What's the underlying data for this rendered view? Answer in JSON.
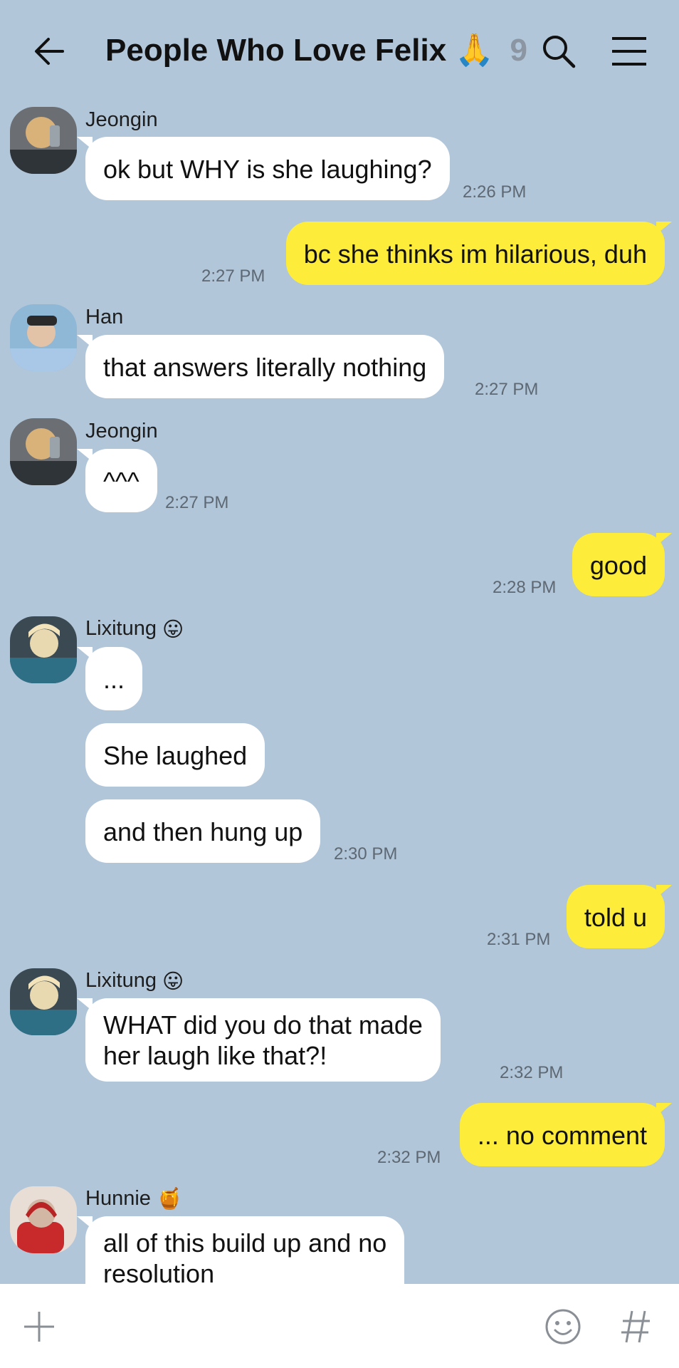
{
  "header": {
    "title": "People Who Love Felix",
    "title_emoji": "🙏",
    "member_count": "9",
    "icons": [
      "back-arrow-icon",
      "search-icon",
      "menu-icon"
    ]
  },
  "colors": {
    "background": "#b2c6da",
    "incoming_bubble": "#ffffff",
    "outgoing_bubble": "#fdec3a"
  },
  "messages": [
    {
      "sender": "Jeongin",
      "text": "ok but WHY is she laughing?",
      "time": "2:26 PM"
    },
    {
      "sender": "me",
      "text": "bc she thinks im hilarious, duh",
      "time": "2:27 PM"
    },
    {
      "sender": "Han",
      "text": "that answers literally nothing",
      "time": "2:27 PM"
    },
    {
      "sender": "Jeongin",
      "text": "^^^",
      "time": "2:27 PM"
    },
    {
      "sender": "me",
      "text": "good",
      "time": "2:28 PM"
    },
    {
      "sender": "Lixitung",
      "sender_emoji": "😛",
      "text": "...",
      "time": ""
    },
    {
      "sender": "Lixitung",
      "text": "She laughed",
      "time": ""
    },
    {
      "sender": "Lixitung",
      "text": "and then hung up",
      "time": "2:30 PM"
    },
    {
      "sender": "me",
      "text": "told u",
      "time": "2:31 PM"
    },
    {
      "sender": "Lixitung",
      "sender_emoji": "😛",
      "text_line1": "WHAT did you do that made",
      "text_line2": "her laugh like that?!",
      "time": "2:32 PM"
    },
    {
      "sender": "me",
      "text": "... no comment",
      "time": "2:32 PM"
    },
    {
      "sender": "Hunnie",
      "sender_emoji": "🍯",
      "text_line1": "all of this build up and no",
      "text_line2": "resolution",
      "time": ""
    }
  ],
  "composer": {
    "icons": [
      "plus-icon",
      "emoji-icon",
      "hashtag-icon"
    ]
  }
}
